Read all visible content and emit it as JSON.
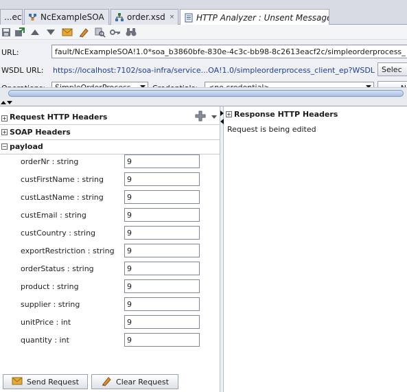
{
  "tabs": [
    {
      "label": "...ect",
      "icon": "close-icon"
    },
    {
      "label": "NcExampleSOA",
      "icon": "composite-icon"
    },
    {
      "label": "order.xsd",
      "icon": "schema-icon"
    },
    {
      "label": "HTTP Analyzer : Unsent Message",
      "icon": "document-icon",
      "active": true
    }
  ],
  "tab_close": "×",
  "toolbar": {
    "icons": [
      "save-icon",
      "export-icon",
      "up-arrow-icon",
      "down-arrow-icon",
      "envelope-icon",
      "edit-icon",
      "zoom-icon",
      "key-icon",
      "binoculars-icon"
    ]
  },
  "form": {
    "url_label": "URL:",
    "url_value": "fault/NcExampleSOA!1.0*soa_b3860bfe-830e-4c3c-bb98-8c2613eacf2c/simpleorderprocess_",
    "wsdl_label": "WSDL URL:",
    "wsdl_value": "https://localhost:7102/soa-infra/service...OA!1.0/simpleorderprocess_client_ep?WSDL",
    "select_label": "Selec",
    "operations_label": "Operations:",
    "operations_value": "SimpleOrderProcess",
    "credentials_label": "Credentials:",
    "credentials_value": "<no credential>",
    "partial_button": "N"
  },
  "left": {
    "request_headers": "Request HTTP Headers",
    "soap_headers": "SOAP Headers",
    "payload": "payload",
    "fields": [
      {
        "label": "orderNr : string",
        "value": "9"
      },
      {
        "label": "custFirstName : string",
        "value": "9"
      },
      {
        "label": "custLastName : string",
        "value": "9"
      },
      {
        "label": "custEmail : string",
        "value": "9"
      },
      {
        "label": "custCountry : string",
        "value": "9"
      },
      {
        "label": "exportRestriction : string",
        "value": "9"
      },
      {
        "label": "orderStatus : string",
        "value": "9"
      },
      {
        "label": "product : string",
        "value": "9"
      },
      {
        "label": "supplier : string",
        "value": "9"
      },
      {
        "label": "unitPrice : int",
        "value": "9"
      },
      {
        "label": "quantity : int",
        "value": "9"
      }
    ],
    "send_button": "Send Request",
    "clear_button": "Clear Request"
  },
  "right": {
    "response_headers": "Response HTTP Headers",
    "status": "Request is being edited"
  },
  "colors": {
    "link": "#1f3e99",
    "accent": "#7e98c4"
  }
}
